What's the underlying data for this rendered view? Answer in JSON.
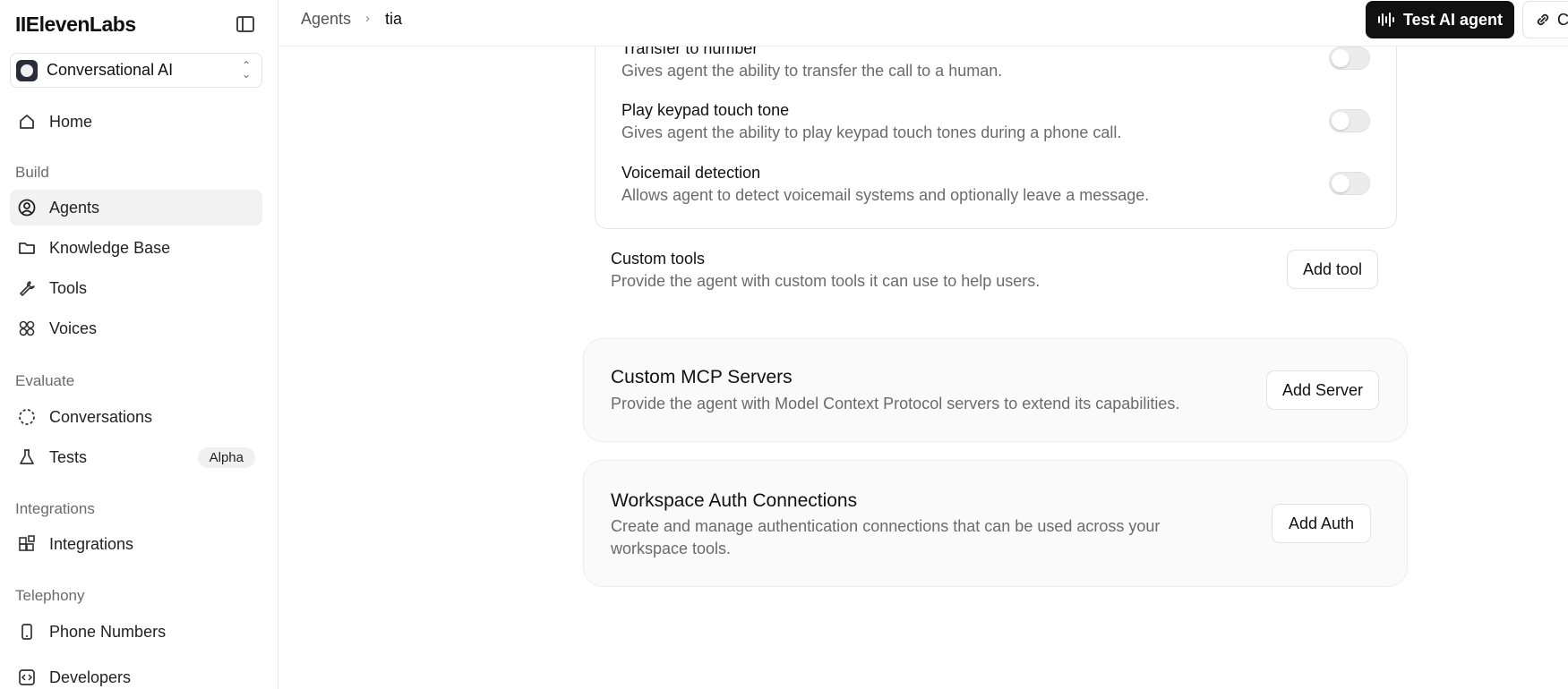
{
  "sidebar": {
    "logo": "IIElevenLabs",
    "workspace": "Conversational AI",
    "home": "Home",
    "sections": {
      "build": "Build",
      "evaluate": "Evaluate",
      "integrations": "Integrations",
      "telephony": "Telephony"
    },
    "items": {
      "agents": "Agents",
      "knowledge_base": "Knowledge Base",
      "tools": "Tools",
      "voices": "Voices",
      "conversations": "Conversations",
      "tests": "Tests",
      "tests_badge": "Alpha",
      "integrations": "Integrations",
      "phone_numbers": "Phone Numbers",
      "developers": "Developers"
    }
  },
  "header": {
    "breadcrumb": [
      "Agents",
      "tia"
    ],
    "test_button": "Test AI agent",
    "copy_button": "C"
  },
  "system_tools": [
    {
      "title": "Transfer to number",
      "desc": "Gives agent the ability to transfer the call to a human.",
      "enabled": false
    },
    {
      "title": "Play keypad touch tone",
      "desc": "Gives agent the ability to play keypad touch tones during a phone call.",
      "enabled": false
    },
    {
      "title": "Voicemail detection",
      "desc": "Allows agent to detect voicemail systems and optionally leave a message.",
      "enabled": false
    }
  ],
  "custom_tools": {
    "title": "Custom tools",
    "desc": "Provide the agent with custom tools it can use to help users.",
    "button": "Add tool"
  },
  "mcp": {
    "title": "Custom MCP Servers",
    "desc": "Provide the agent with Model Context Protocol servers to extend its capabilities.",
    "button": "Add Server"
  },
  "auth": {
    "title": "Workspace Auth Connections",
    "desc": "Create and manage authentication connections that can be used across your workspace tools.",
    "button": "Add Auth"
  },
  "colors": {
    "primary_button": "#111111",
    "muted_text": "#6b6b6b",
    "active_nav": "#f2f2f2"
  }
}
